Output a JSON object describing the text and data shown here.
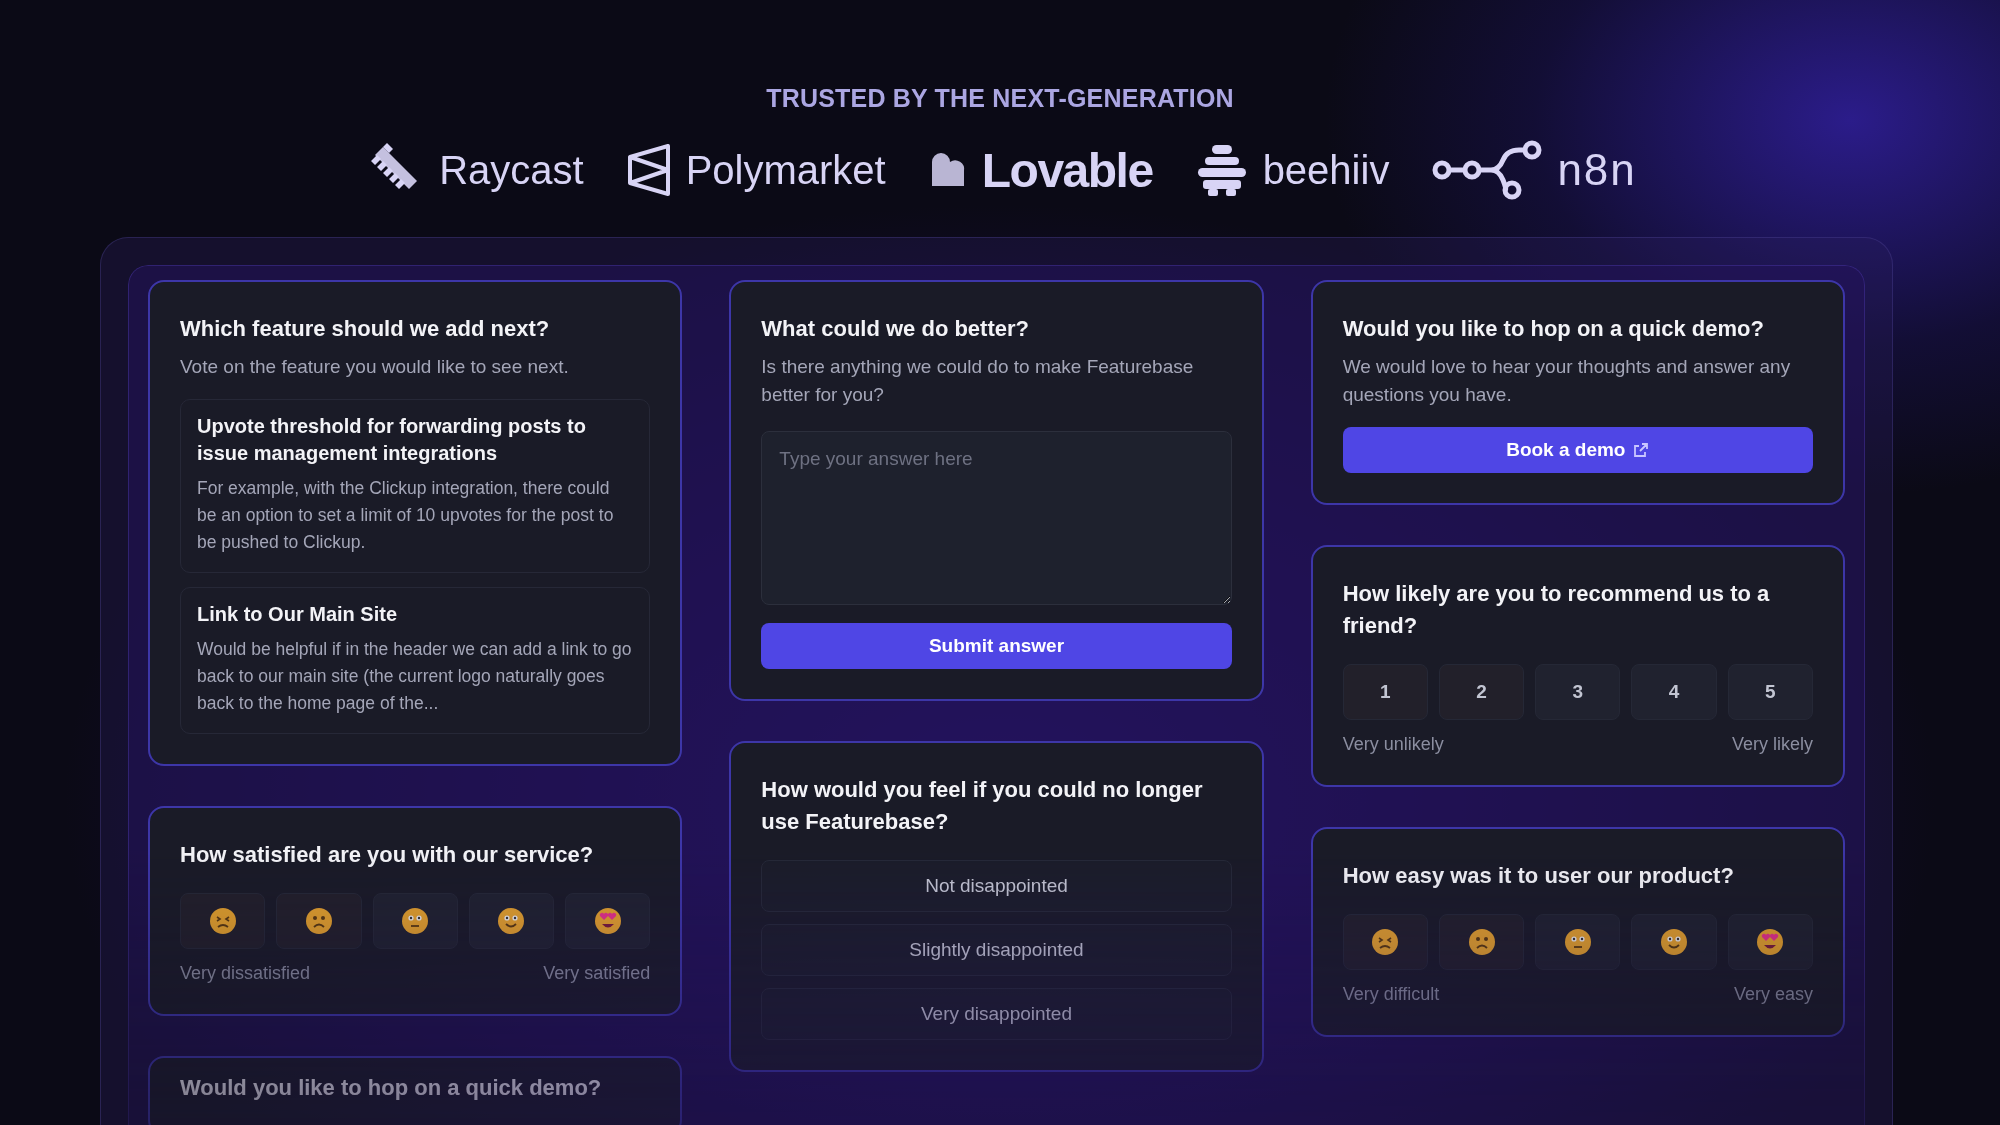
{
  "header": {
    "tagline": "TRUSTED BY THE NEXT-GENERATION"
  },
  "logos": [
    {
      "kind": "raycast",
      "name": "Raycast"
    },
    {
      "kind": "polymarket",
      "name": "Polymarket"
    },
    {
      "kind": "lovable",
      "name": "Lovable"
    },
    {
      "kind": "beehiiv",
      "name": "beehiiv"
    },
    {
      "kind": "n8n",
      "name": "n8n"
    }
  ],
  "columns": [
    {
      "cards": [
        {
          "kind": "posts",
          "title": "Which feature should we add next?",
          "description": "Vote on the feature you would like to see next.",
          "posts": [
            {
              "title": "Upvote threshold for forwarding posts to issue management integrations",
              "body": "For example, with the Clickup integration, there could be an option to set a limit of 10 upvotes for the post to be pushed to Clickup."
            },
            {
              "title": "Link to Our Main Site",
              "body": "Would be helpful if in the header we can add a link to go back to our main site (the current logo naturally goes back to the home page of the..."
            }
          ]
        },
        {
          "kind": "emoji",
          "title": "How satisfied are you with our service?",
          "options": [
            {
              "kind": "tired"
            },
            {
              "kind": "frown"
            },
            {
              "kind": "neutral"
            },
            {
              "kind": "smile"
            },
            {
              "kind": "hearts"
            }
          ],
          "low_label": "Very dissatisfied",
          "high_label": "Very satisfied"
        },
        {
          "kind": "peek",
          "title": "Would you like to hop on a quick demo?"
        }
      ]
    },
    {
      "cards": [
        {
          "kind": "text_answer",
          "title": "What could we do better?",
          "description": "Is there anything we could do to make Featurebase better for you?",
          "placeholder": "Type your answer here",
          "button": "Submit answer"
        },
        {
          "kind": "choices",
          "title": "How would you feel if you could no longer use Featurebase?",
          "options": [
            "Not disappointed",
            "Slightly disappointed",
            "Very disappointed"
          ]
        }
      ]
    },
    {
      "cards": [
        {
          "kind": "demo",
          "title": "Would you like to hop on a quick demo?",
          "description": "We would love to hear your thoughts and answer any questions you have.",
          "button": "Book a demo"
        },
        {
          "kind": "scale",
          "title": "How likely are you to recommend us to a friend?",
          "options": [
            "1",
            "2",
            "3",
            "4",
            "5"
          ],
          "low_label": "Very unlikely",
          "high_label": "Very likely"
        },
        {
          "kind": "emoji",
          "title": "How easy was it to user our product?",
          "options": [
            {
              "kind": "tired"
            },
            {
              "kind": "frown"
            },
            {
              "kind": "neutral"
            },
            {
              "kind": "smile"
            },
            {
              "kind": "hearts"
            }
          ],
          "low_label": "Very difficult",
          "high_label": "Very easy"
        }
      ]
    }
  ]
}
